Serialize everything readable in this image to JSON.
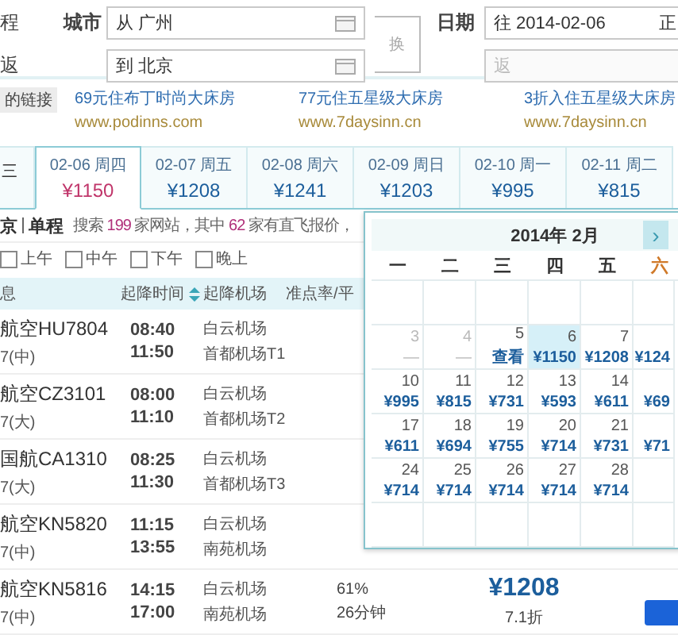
{
  "form": {
    "trip_label_1": "程",
    "trip_label_2": "返",
    "city_label": "城市",
    "from": "从 广州",
    "to": "到 北京",
    "swap": "换",
    "date_label": "日期",
    "depart": "往 2014-02-06",
    "depart_note": "正",
    "return_placeholder": "返"
  },
  "ads": {
    "tag": "的链接",
    "items": [
      {
        "title": "69元住布丁时尚大床房",
        "url": "www.podinns.com"
      },
      {
        "title": "77元住五星级大床房",
        "url": "www.7daysinn.cn"
      },
      {
        "title": "3折入住五星级大床房",
        "url": "www.7daysinn.cn"
      }
    ]
  },
  "date_tabs": [
    {
      "label": "三",
      "selected": false
    },
    {
      "label": "02-06 周四",
      "price": "¥1150",
      "selected": true
    },
    {
      "label": "02-07 周五",
      "price": "¥1208",
      "selected": false
    },
    {
      "label": "02-08 周六",
      "price": "¥1241",
      "selected": false
    },
    {
      "label": "02-09 周日",
      "price": "¥1203",
      "selected": false
    },
    {
      "label": "02-10 周一",
      "price": "¥995",
      "selected": false
    },
    {
      "label": "02-11 周二",
      "price": "¥815",
      "selected": false
    }
  ],
  "summary": {
    "route": "京",
    "trip": "单程",
    "parts": [
      {
        "text": "搜索 ",
        "highlight": false
      },
      {
        "text": "199",
        "highlight": true
      },
      {
        "text": " 家网站，其中 ",
        "highlight": false
      },
      {
        "text": "62",
        "highlight": true
      },
      {
        "text": " 家有直飞报价，",
        "highlight": false
      }
    ]
  },
  "filters": [
    {
      "label": "上午",
      "checked": false
    },
    {
      "label": "中午",
      "checked": false
    },
    {
      "label": "下午",
      "checked": false
    },
    {
      "label": "晚上",
      "checked": false
    }
  ],
  "table": {
    "columns": [
      {
        "label": "息",
        "sort": false
      },
      {
        "label": "起降时间",
        "sort": true
      },
      {
        "label": "起降机场",
        "sort": false
      },
      {
        "label": "准点率/平",
        "sort": false
      }
    ],
    "rows": [
      {
        "flight": "航空HU7804",
        "plane": "7(中)",
        "depart": "08:40",
        "arrive": "11:50",
        "from_airport": "白云机场",
        "to_airport": "首都机场T1"
      },
      {
        "flight": "航空CZ3101",
        "plane": "7(大)",
        "depart": "08:00",
        "arrive": "11:10",
        "from_airport": "白云机场",
        "to_airport": "首都机场T2"
      },
      {
        "flight": "国航CA1310",
        "plane": "7(大)",
        "depart": "08:25",
        "arrive": "11:30",
        "from_airport": "白云机场",
        "to_airport": "首都机场T3"
      },
      {
        "flight": "航空KN5820",
        "plane": "7(中)",
        "depart": "11:15",
        "arrive": "13:55",
        "from_airport": "白云机场",
        "to_airport": "南苑机场"
      },
      {
        "flight": "航空KN5816",
        "plane": "7(中)",
        "depart": "14:15",
        "arrive": "17:00",
        "from_airport": "白云机场",
        "to_airport": "南苑机场",
        "punctuality": "61%",
        "delay": "26分钟",
        "price": "¥1208",
        "discount": "7.1折"
      }
    ]
  },
  "calendar": {
    "title": "2014年 2月",
    "next": "›",
    "weekdays": [
      {
        "label": "一",
        "weekend": false
      },
      {
        "label": "二",
        "weekend": false
      },
      {
        "label": "三",
        "weekend": false
      },
      {
        "label": "四",
        "weekend": false
      },
      {
        "label": "五",
        "weekend": false
      },
      {
        "label": "六",
        "weekend": true
      }
    ],
    "weeks": [
      [
        {
          "kind": "blank"
        },
        {
          "kind": "blank"
        },
        {
          "kind": "blank"
        },
        {
          "kind": "blank"
        },
        {
          "kind": "blank"
        },
        {
          "kind": "blank"
        }
      ],
      [
        {
          "kind": "past",
          "day": "3",
          "price": "—"
        },
        {
          "kind": "past",
          "day": "4",
          "price": "—"
        },
        {
          "kind": "day",
          "day": "5",
          "price": "查看",
          "selected": false
        },
        {
          "kind": "day",
          "day": "6",
          "price": "¥1150",
          "selected": true
        },
        {
          "kind": "day",
          "day": "7",
          "price": "¥1208",
          "selected": false
        },
        {
          "kind": "day",
          "price": "¥124",
          "selected": false
        }
      ],
      [
        {
          "kind": "day",
          "day": "10",
          "price": "¥995",
          "selected": false
        },
        {
          "kind": "day",
          "day": "11",
          "price": "¥815",
          "selected": false
        },
        {
          "kind": "day",
          "day": "12",
          "price": "¥731",
          "selected": false
        },
        {
          "kind": "day",
          "day": "13",
          "price": "¥593",
          "selected": false
        },
        {
          "kind": "day",
          "day": "14",
          "price": "¥611",
          "selected": false
        },
        {
          "kind": "day",
          "price": "¥69",
          "selected": false
        }
      ],
      [
        {
          "kind": "day",
          "day": "17",
          "price": "¥611",
          "selected": false
        },
        {
          "kind": "day",
          "day": "18",
          "price": "¥694",
          "selected": false
        },
        {
          "kind": "day",
          "day": "19",
          "price": "¥755",
          "selected": false
        },
        {
          "kind": "day",
          "day": "20",
          "price": "¥714",
          "selected": false
        },
        {
          "kind": "day",
          "day": "21",
          "price": "¥731",
          "selected": false
        },
        {
          "kind": "day",
          "price": "¥71",
          "selected": false
        }
      ],
      [
        {
          "kind": "day",
          "day": "24",
          "price": "¥714",
          "selected": false
        },
        {
          "kind": "day",
          "day": "25",
          "price": "¥714",
          "selected": false
        },
        {
          "kind": "day",
          "day": "26",
          "price": "¥714",
          "selected": false
        },
        {
          "kind": "day",
          "day": "27",
          "price": "¥714",
          "selected": false
        },
        {
          "kind": "day",
          "day": "28",
          "price": "¥714",
          "selected": false
        },
        {
          "kind": "blank"
        }
      ],
      [
        {
          "kind": "blank"
        },
        {
          "kind": "blank"
        },
        {
          "kind": "blank"
        },
        {
          "kind": "blank"
        },
        {
          "kind": "blank"
        },
        {
          "kind": "blank"
        }
      ]
    ]
  }
}
